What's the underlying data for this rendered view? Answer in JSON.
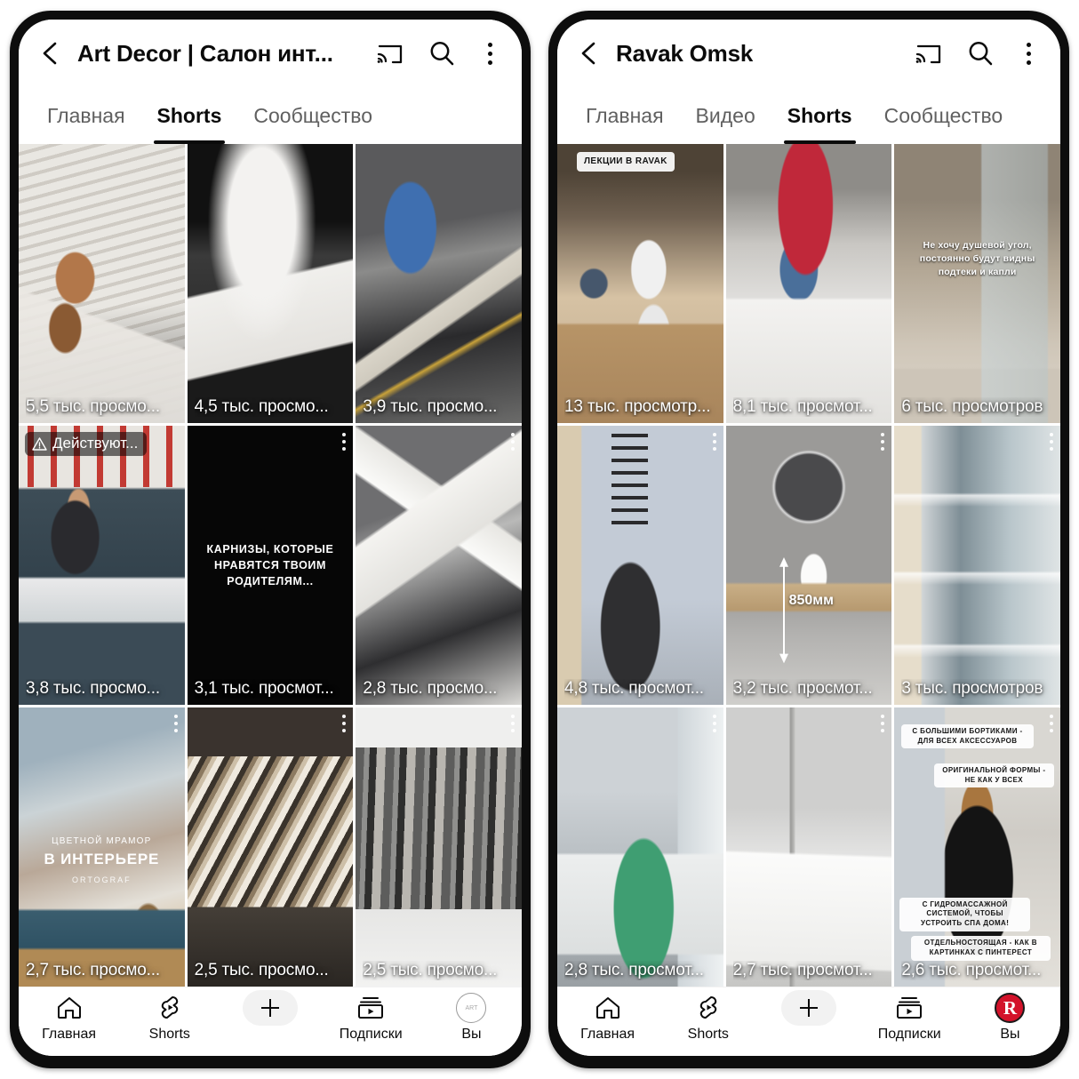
{
  "phones": [
    {
      "id": "left",
      "appbar": {
        "back_icon": "back-arrow-icon",
        "title": "Art Decor | Салон инт...",
        "cast_icon": "cast-icon",
        "search_icon": "search-icon",
        "more_icon": "kebab-menu-icon"
      },
      "tabs": [
        {
          "label": "Главная",
          "active": false
        },
        {
          "label": "Shorts",
          "active": true
        },
        {
          "label": "Сообщество",
          "active": false
        }
      ],
      "grid": [
        {
          "views": "5,5 тыс. просмо...",
          "kebab": false,
          "overlay": null
        },
        {
          "views": "4,5 тыс. просмо...",
          "kebab": false,
          "overlay": null
        },
        {
          "views": "3,9 тыс. просмо...",
          "kebab": false,
          "overlay": null
        },
        {
          "views": "3,8 тыс. просмо...",
          "kebab": false,
          "overlay": {
            "type": "warn-chip",
            "text": "Действуют..."
          }
        },
        {
          "views": "3,1 тыс. просмот...",
          "kebab": true,
          "overlay": {
            "type": "center-caption",
            "text": "КАРНИЗЫ, КОТОРЫЕ НРАВЯТСЯ ТВОИМ РОДИТЕЛЯМ..."
          }
        },
        {
          "views": "2,8 тыс. просмо...",
          "kebab": true,
          "overlay": null
        },
        {
          "views": "2,7 тыс. просмо...",
          "kebab": true,
          "overlay": {
            "type": "marble",
            "small": "ЦВЕТНОЙ МРАМОР",
            "big": "В ИНТЕРЬЕРЕ",
            "brand": "ORTOGRAF"
          }
        },
        {
          "views": "2,5 тыс. просмо...",
          "kebab": true,
          "overlay": null
        },
        {
          "views": "2,5 тыс. просмо...",
          "kebab": true,
          "overlay": null
        }
      ],
      "bottomnav": [
        {
          "label": "Главная",
          "icon": "home-icon"
        },
        {
          "label": "Shorts",
          "icon": "shorts-icon"
        },
        {
          "label": "",
          "icon": "plus-icon"
        },
        {
          "label": "Подписки",
          "icon": "subscriptions-icon"
        },
        {
          "label": "Вы",
          "icon": "avatar-placeholder-icon"
        }
      ]
    },
    {
      "id": "right",
      "appbar": {
        "back_icon": "back-arrow-icon",
        "title": "Ravak Omsk",
        "cast_icon": "cast-icon",
        "search_icon": "search-icon",
        "more_icon": "kebab-menu-icon"
      },
      "tabs": [
        {
          "label": "Главная",
          "active": false
        },
        {
          "label": "Видео",
          "active": false
        },
        {
          "label": "Shorts",
          "active": true
        },
        {
          "label": "Сообщество",
          "active": false
        }
      ],
      "grid": [
        {
          "views": "13 тыс. просмотр...",
          "kebab": false,
          "overlay": {
            "type": "chip-top",
            "text": "ЛЕКЦИИ В RAVAK"
          }
        },
        {
          "views": "8,1 тыс. просмот...",
          "kebab": false,
          "overlay": null
        },
        {
          "views": "6 тыс. просмотров",
          "kebab": false,
          "overlay": {
            "type": "shadow-text",
            "text": "Не хочу душевой угол, постоянно будут видны подтеки и капли"
          }
        },
        {
          "views": "4,8 тыс. просмот...",
          "kebab": true,
          "overlay": null
        },
        {
          "views": "3,2 тыс. просмот...",
          "kebab": true,
          "overlay": {
            "type": "dimension",
            "text": "850мм"
          }
        },
        {
          "views": "3 тыс. просмотров",
          "kebab": true,
          "overlay": null
        },
        {
          "views": "2,8 тыс. просмот...",
          "kebab": true,
          "overlay": null
        },
        {
          "views": "2,7 тыс. просмот...",
          "kebab": true,
          "overlay": null
        },
        {
          "views": "2,6 тыс. просмот...",
          "kebab": true,
          "overlay": {
            "type": "chips-stack",
            "items": [
              "С БОЛЬШИМИ БОРТИКАМИ - ДЛЯ ВСЕХ АКСЕССУАРОВ",
              "ОРИГИНАЛЬНОЙ ФОРМЫ - НЕ КАК У ВСЕХ",
              "С ГИДРОМАССАЖНОЙ СИСТЕМОЙ, ЧТОБЫ УСТРОИТЬ СПА ДОМА!",
              "ОТДЕЛЬНОСТОЯЩАЯ - КАК В КАРТИНКАХ С ПИНТЕРЕСТ"
            ]
          }
        }
      ],
      "bottomnav": [
        {
          "label": "Главная",
          "icon": "home-icon"
        },
        {
          "label": "Shorts",
          "icon": "shorts-icon"
        },
        {
          "label": "",
          "icon": "plus-icon"
        },
        {
          "label": "Подписки",
          "icon": "subscriptions-icon"
        },
        {
          "label": "Вы",
          "icon": "avatar-ravak-icon"
        }
      ]
    }
  ],
  "colors": {
    "accent_red": "#d3122a",
    "active_tab": "#0b0b0b",
    "inactive_tab": "#606060",
    "frame": "#0d0d0d"
  }
}
